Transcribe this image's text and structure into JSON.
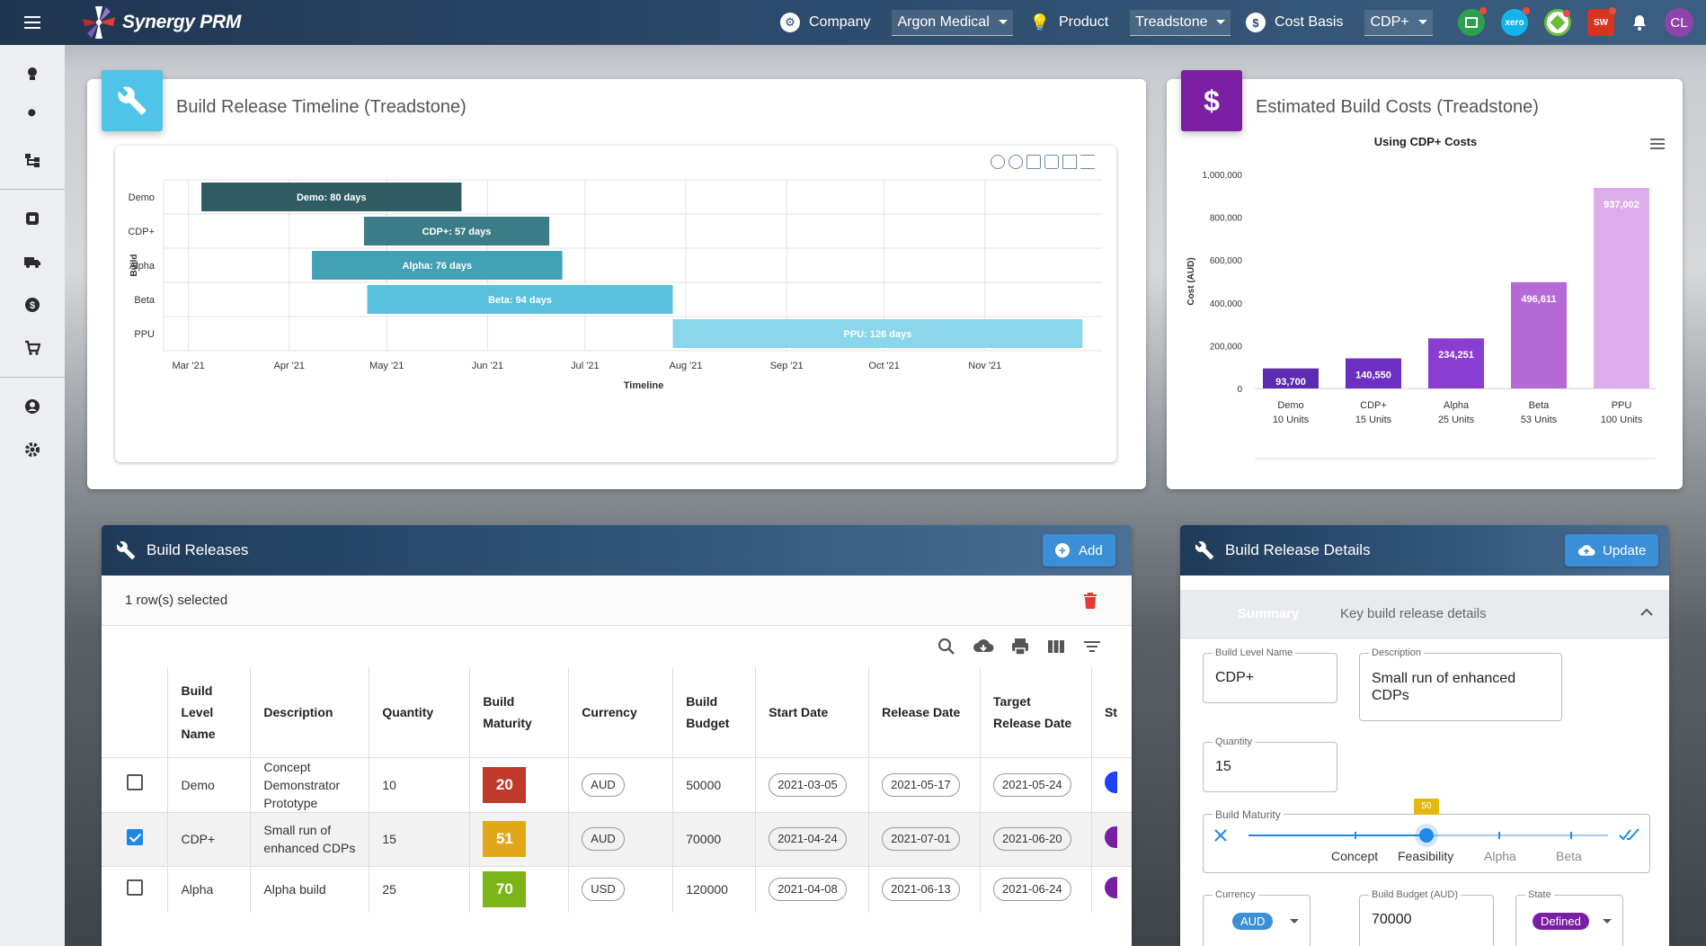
{
  "app": {
    "name": "Synergy PRM"
  },
  "topbar": {
    "company_label": "Company",
    "company_value": "Argon Medical",
    "product_label": "Product",
    "product_value": "Treadstone",
    "costbasis_label": "Cost Basis",
    "costbasis_value": "CDP+",
    "avatar_initials": "CL",
    "apps": [
      {
        "name": "sheets-app-icon",
        "color": "#2e9f4f"
      },
      {
        "name": "xero-app-icon",
        "color": "#13b5ea",
        "label": "xero"
      },
      {
        "name": "hex-app-icon",
        "color": "#6abf3a"
      },
      {
        "name": "sw-app-icon",
        "color": "#d7331f",
        "label": "SW"
      }
    ]
  },
  "timeline": {
    "title": "Build Release Timeline (Treadstone)"
  },
  "costs": {
    "title": "Estimated Build Costs (Treadstone)"
  },
  "chart_data": [
    {
      "type": "bar",
      "orientation": "horizontal-range",
      "ylabel": "Build",
      "xlabel": "Timeline",
      "categories": [
        "Demo",
        "CDP+",
        "Alpha",
        "Beta",
        "PPU"
      ],
      "x_ticks": [
        "Mar '21",
        "Apr '21",
        "May '21",
        "Jun '21",
        "Jul '21",
        "Aug '21",
        "Sep '21",
        "Oct '21",
        "Nov '21"
      ],
      "series": [
        {
          "start": "2021-03-05",
          "end": "2021-05-24",
          "label": "Demo: 80 days",
          "color": "#2f5c62"
        },
        {
          "start": "2021-04-24",
          "end": "2021-06-20",
          "label": "CDP+: 57 days",
          "color": "#3c7c86"
        },
        {
          "start": "2021-04-08",
          "end": "2021-06-24",
          "label": "Alpha: 76 days",
          "color": "#42a1b5"
        },
        {
          "start": "2021-04-25",
          "end": "2021-07-28",
          "label": "Beta: 94 days",
          "color": "#59c1dc"
        },
        {
          "start": "2021-07-28",
          "end": "2021-12-01",
          "label": "PPU: 126 days",
          "color": "#8ad6ea"
        }
      ]
    },
    {
      "type": "bar",
      "title": "Using CDP+ Costs",
      "ylabel": "Cost (AUD)",
      "ylim": [
        0,
        1000000
      ],
      "y_ticks": [
        "0",
        "200,000",
        "400,000",
        "600,000",
        "800,000",
        "1,000,000"
      ],
      "categories": [
        "Demo",
        "CDP+",
        "Alpha",
        "Beta",
        "PPU"
      ],
      "category_sub": [
        "10 Units",
        "15 Units",
        "25 Units",
        "53 Units",
        "100 Units"
      ],
      "values": [
        93700,
        140550,
        234251,
        496611,
        937002
      ],
      "value_labels": [
        "93,700",
        "140,550",
        "234,251",
        "496,611",
        "937,002"
      ],
      "colors": [
        "#5b2bb0",
        "#6c2fc2",
        "#8a3dd1",
        "#b56ad8",
        "#dcaee9"
      ]
    }
  ],
  "releases": {
    "title": "Build Releases",
    "add_label": "Add",
    "selection_text": "1 row(s) selected",
    "columns": [
      "Build Level Name",
      "Description",
      "Quantity",
      "Build Maturity",
      "Currency",
      "Build Budget",
      "Start Date",
      "Release Date",
      "Target Release Date",
      "St"
    ],
    "rows": [
      {
        "name": "Demo",
        "desc": "Concept Demonstrator Prototype",
        "qty": "10",
        "maturity": "20",
        "mat_color": "#c0392b",
        "currency": "AUD",
        "budget": "50000",
        "start": "2021-03-05",
        "release": "2021-05-17",
        "target": "2021-05-24",
        "selected": false
      },
      {
        "name": "CDP+",
        "desc": "Small run of enhanced CDPs",
        "qty": "15",
        "maturity": "51",
        "mat_color": "#e3a81a",
        "currency": "AUD",
        "budget": "70000",
        "start": "2021-04-24",
        "release": "2021-07-01",
        "target": "2021-06-20",
        "selected": true
      },
      {
        "name": "Alpha",
        "desc": "Alpha build",
        "qty": "25",
        "maturity": "70",
        "mat_color": "#7cb518",
        "currency": "USD",
        "budget": "120000",
        "start": "2021-04-08",
        "release": "2021-06-13",
        "target": "2021-06-24",
        "selected": false
      }
    ]
  },
  "details": {
    "title": "Build Release Details",
    "update_label": "Update",
    "summary_tab": "Summary",
    "summary_desc": "Key build release details",
    "build_level_name_label": "Build Level Name",
    "build_level_name": "CDP+",
    "description_label": "Description",
    "description": "Small run of enhanced CDPs",
    "quantity_label": "Quantity",
    "quantity": "15",
    "maturity_label": "Build Maturity",
    "maturity_value": "50",
    "maturity_steps": [
      "Concept",
      "Feasibility",
      "Alpha",
      "Beta"
    ],
    "currency_label": "Currency",
    "currency": "AUD",
    "budget_label": "Build Budget (AUD)",
    "budget": "70000",
    "state_label": "State",
    "state": "Defined"
  }
}
